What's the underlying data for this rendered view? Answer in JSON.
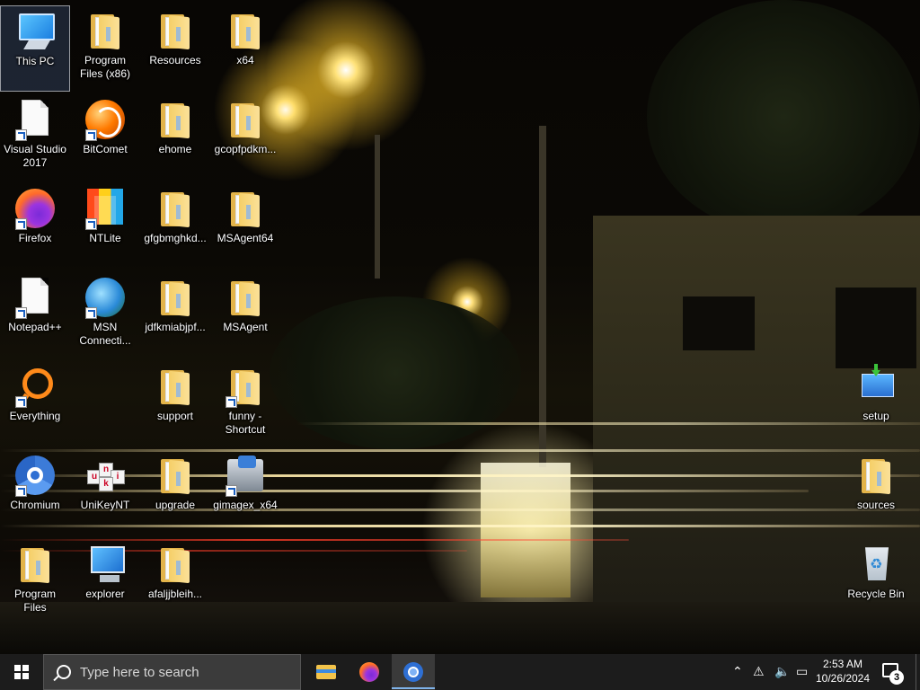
{
  "desktop": {
    "icons": [
      {
        "label": "This PC",
        "icon": "this-pc-icon"
      },
      {
        "label": "Program Files (x86)",
        "icon": "folder-icon"
      },
      {
        "label": "Resources",
        "icon": "folder-icon"
      },
      {
        "label": "x64",
        "icon": "folder-icon"
      },
      {
        "label": "Visual Studio 2017",
        "icon": "file-shortcut-icon"
      },
      {
        "label": "BitComet",
        "icon": "bitcomet-icon"
      },
      {
        "label": "ehome",
        "icon": "folder-icon"
      },
      {
        "label": "gcopfpdkm...",
        "icon": "folder-icon"
      },
      {
        "label": "Firefox",
        "icon": "firefox-icon"
      },
      {
        "label": "NTLite",
        "icon": "ntlite-icon"
      },
      {
        "label": "gfgbmghkd...",
        "icon": "folder-icon"
      },
      {
        "label": "MSAgent64",
        "icon": "folder-icon"
      },
      {
        "label": "Notepad++",
        "icon": "file-shortcut-icon"
      },
      {
        "label": "MSN Connecti...",
        "icon": "msn-icon"
      },
      {
        "label": "jdfkmiabjpf...",
        "icon": "folder-icon"
      },
      {
        "label": "MSAgent",
        "icon": "folder-icon"
      },
      {
        "label": "Everything",
        "icon": "everything-icon"
      },
      {
        "label": "support",
        "icon": "folder-icon"
      },
      {
        "label": "funny - Shortcut",
        "icon": "folder-shortcut-icon"
      },
      {
        "label": "Chromium",
        "icon": "chromium-icon"
      },
      {
        "label": "UniKeyNT",
        "icon": "unikey-icon"
      },
      {
        "label": "upgrade",
        "icon": "folder-icon"
      },
      {
        "label": "gimagex_x64",
        "icon": "gimagex-icon"
      },
      {
        "label": "Program Files",
        "icon": "folder-icon"
      },
      {
        "label": "explorer",
        "icon": "explorer-icon"
      },
      {
        "label": "afaljjbleih...",
        "icon": "folder-icon"
      },
      {
        "label": "setup",
        "icon": "setup-icon"
      },
      {
        "label": "sources",
        "icon": "folder-icon"
      },
      {
        "label": "Recycle Bin",
        "icon": "recycle-bin-icon"
      }
    ]
  },
  "taskbar": {
    "search_placeholder": "Type here to search",
    "pinned": [
      {
        "name": "File Explorer",
        "icon": "file-explorer-icon"
      },
      {
        "name": "Firefox",
        "icon": "firefox-icon"
      },
      {
        "name": "Chromium",
        "icon": "chromium-icon"
      }
    ],
    "tray": {
      "time": "2:53 AM",
      "date": "10/26/2024",
      "notification_count": "3"
    }
  }
}
